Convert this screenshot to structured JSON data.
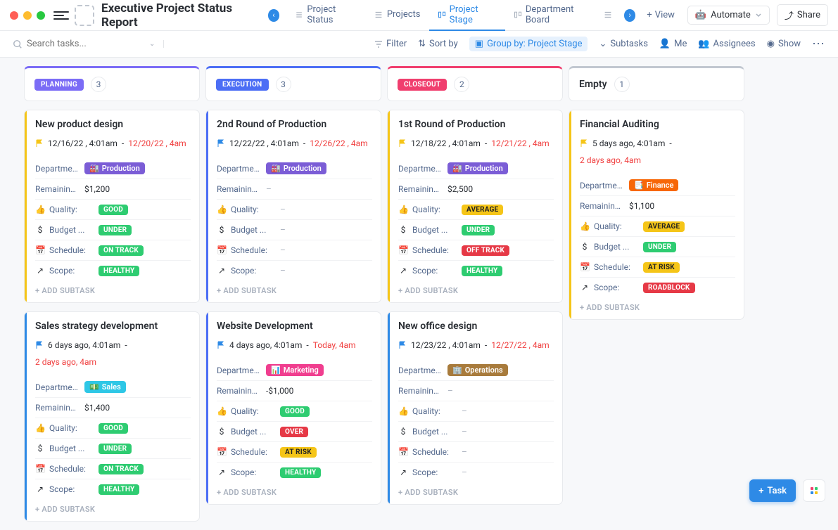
{
  "header": {
    "title": "Executive Project Status Report",
    "tabs": [
      {
        "label": "Project Status"
      },
      {
        "label": "Projects"
      },
      {
        "label": "Project Stage"
      },
      {
        "label": "Department Board"
      }
    ],
    "view": "View",
    "automate": "Automate",
    "share": "Share"
  },
  "toolbar": {
    "search_placeholder": "Search tasks...",
    "filter": "Filter",
    "sortby": "Sort by",
    "groupby": "Group by: Project Stage",
    "subtasks": "Subtasks",
    "me": "Me",
    "assignees": "Assignees",
    "show": "Show"
  },
  "columns": [
    {
      "stage": "PLANNING",
      "count": "3",
      "cls": "planning",
      "card_ids": [
        "c0",
        "c1"
      ]
    },
    {
      "stage": "EXECUTION",
      "count": "3",
      "cls": "execution",
      "card_ids": [
        "c2",
        "c3"
      ]
    },
    {
      "stage": "CLOSEOUT",
      "count": "2",
      "cls": "closeout",
      "card_ids": [
        "c4",
        "c5"
      ]
    },
    {
      "stage": "Empty",
      "count": "1",
      "cls": "empty",
      "card_ids": [
        "c6"
      ]
    }
  ],
  "field_labels": {
    "department": "Department:",
    "remaining": "Remaining ...",
    "quality": "Quality:",
    "budget": "Budget ...",
    "schedule": "Schedule:",
    "scope": "Scope:",
    "add_subtask": "+ ADD SUBTASK"
  },
  "cards": {
    "c0": {
      "title": "New product design",
      "stripe": "#f5c518",
      "flag": "#f5c518",
      "date1": "12/16/22 , 4:01am",
      "sep": "-",
      "date2": "12/20/22 , 4am",
      "date2_red": true,
      "dept": {
        "name": "Production",
        "cls": "production",
        "icon": "🏭"
      },
      "remaining": "$1,200",
      "quality": {
        "txt": "GOOD",
        "cls": "bg-green"
      },
      "budget": {
        "txt": "UNDER",
        "cls": "bg-green"
      },
      "schedule": {
        "txt": "ON TRACK",
        "cls": "bg-green"
      },
      "scope": {
        "txt": "HEALTHY",
        "cls": "bg-green"
      }
    },
    "c1": {
      "title": "Sales strategy development",
      "stripe": "#2e8ae6",
      "flag": "#2e8ae6",
      "date1": "6 days ago, 4:01am",
      "sep": "-",
      "date2": "",
      "date3": "2 days ago, 4am",
      "dept": {
        "name": "Sales",
        "cls": "sales",
        "icon": "💵"
      },
      "remaining": "$1,400",
      "quality": {
        "txt": "GOOD",
        "cls": "bg-green"
      },
      "budget": {
        "txt": "UNDER",
        "cls": "bg-green"
      },
      "schedule": {
        "txt": "ON TRACK",
        "cls": "bg-green"
      },
      "scope": {
        "txt": "HEALTHY",
        "cls": "bg-green"
      }
    },
    "c2": {
      "title": "2nd Round of Production",
      "stripe": "#4c6ef5",
      "flag": "#2e8ae6",
      "date1": "12/22/22 , 4:01am",
      "sep": "-",
      "date2": "12/26/22 , 4am",
      "date2_red": true,
      "dept": {
        "name": "Production",
        "cls": "production",
        "icon": "🏭"
      },
      "remaining": "–",
      "quality": null,
      "budget": null,
      "schedule": null,
      "scope": null
    },
    "c3": {
      "title": "Website Development",
      "stripe": "#4c6ef5",
      "flag": "#2e8ae6",
      "date1": "4 days ago, 4:01am",
      "sep": "-",
      "date2": "Today, 4am",
      "date2_red": true,
      "dept": {
        "name": "Marketing",
        "cls": "marketing",
        "icon": "📊"
      },
      "remaining": "-$1,000",
      "quality": {
        "txt": "GOOD",
        "cls": "bg-green"
      },
      "budget": {
        "txt": "OVER",
        "cls": "bg-red"
      },
      "schedule": {
        "txt": "AT RISK",
        "cls": "bg-yellow"
      },
      "scope": {
        "txt": "HEALTHY",
        "cls": "bg-green"
      }
    },
    "c4": {
      "title": "1st Round of Production",
      "stripe": "#f5c518",
      "flag": "#f5c518",
      "date1": "12/18/22 , 4:01am",
      "sep": "-",
      "date2": "12/21/22 , 4am",
      "date2_red": true,
      "dept": {
        "name": "Production",
        "cls": "production",
        "icon": "🏭"
      },
      "remaining": "$2,500",
      "quality": {
        "txt": "AVERAGE",
        "cls": "bg-yellow"
      },
      "budget": {
        "txt": "UNDER",
        "cls": "bg-green"
      },
      "schedule": {
        "txt": "OFF TRACK",
        "cls": "bg-red"
      },
      "scope": {
        "txt": "HEALTHY",
        "cls": "bg-green"
      }
    },
    "c5": {
      "title": "New office design",
      "stripe": "#2e8ae6",
      "flag": "#2e8ae6",
      "date1": "12/23/22 , 4:01am",
      "sep": "-",
      "date2": "12/27/22 , 4am",
      "date2_red": true,
      "dept": {
        "name": "Operations",
        "cls": "operations",
        "icon": "🏢"
      },
      "remaining": "–",
      "quality": null,
      "budget": null,
      "schedule": null,
      "scope": null
    },
    "c6": {
      "title": "Financial Auditing",
      "stripe": "#f5c518",
      "flag": "#f5c518",
      "date1": "5 days ago, 4:01am",
      "sep": "-",
      "date2": "",
      "date3": "2 days ago, 4am",
      "dept": {
        "name": "Finance",
        "cls": "finance",
        "icon": "📑"
      },
      "remaining": "$1,100",
      "quality": {
        "txt": "AVERAGE",
        "cls": "bg-yellow"
      },
      "budget": {
        "txt": "UNDER",
        "cls": "bg-green"
      },
      "schedule": {
        "txt": "AT RISK",
        "cls": "bg-yellow"
      },
      "scope": {
        "txt": "ROADBLOCK",
        "cls": "bg-red"
      }
    }
  },
  "float": {
    "task": "Task"
  }
}
